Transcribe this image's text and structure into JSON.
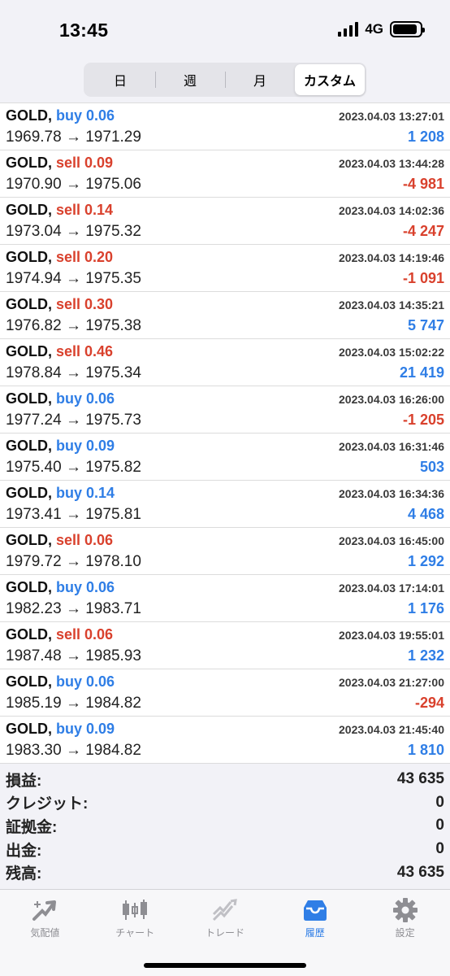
{
  "status": {
    "time": "13:45",
    "network": "4G",
    "battery_level": 0.9
  },
  "period_tabs": [
    {
      "label": "日",
      "active": false
    },
    {
      "label": "週",
      "active": false
    },
    {
      "label": "月",
      "active": false
    },
    {
      "label": "カスタム",
      "active": true
    }
  ],
  "trades": [
    {
      "symbol": "GOLD,",
      "side": "buy",
      "side_text": "buy 0.06",
      "prices": "1969.78 → 1971.29",
      "time": "2023.04.03 13:27:01",
      "profit": "1 208",
      "sign": "pos"
    },
    {
      "symbol": "GOLD,",
      "side": "sell",
      "side_text": "sell 0.09",
      "prices": "1970.90 → 1975.06",
      "time": "2023.04.03 13:44:28",
      "profit": "-4 981",
      "sign": "neg"
    },
    {
      "symbol": "GOLD,",
      "side": "sell",
      "side_text": "sell 0.14",
      "prices": "1973.04 → 1975.32",
      "time": "2023.04.03 14:02:36",
      "profit": "-4 247",
      "sign": "neg"
    },
    {
      "symbol": "GOLD,",
      "side": "sell",
      "side_text": "sell 0.20",
      "prices": "1974.94 → 1975.35",
      "time": "2023.04.03 14:19:46",
      "profit": "-1 091",
      "sign": "neg"
    },
    {
      "symbol": "GOLD,",
      "side": "sell",
      "side_text": "sell 0.30",
      "prices": "1976.82 → 1975.38",
      "time": "2023.04.03 14:35:21",
      "profit": "5 747",
      "sign": "pos"
    },
    {
      "symbol": "GOLD,",
      "side": "sell",
      "side_text": "sell 0.46",
      "prices": "1978.84 → 1975.34",
      "time": "2023.04.03 15:02:22",
      "profit": "21 419",
      "sign": "pos"
    },
    {
      "symbol": "GOLD,",
      "side": "buy",
      "side_text": "buy 0.06",
      "prices": "1977.24 → 1975.73",
      "time": "2023.04.03 16:26:00",
      "profit": "-1 205",
      "sign": "neg"
    },
    {
      "symbol": "GOLD,",
      "side": "buy",
      "side_text": "buy 0.09",
      "prices": "1975.40 → 1975.82",
      "time": "2023.04.03 16:31:46",
      "profit": "503",
      "sign": "pos"
    },
    {
      "symbol": "GOLD,",
      "side": "buy",
      "side_text": "buy 0.14",
      "prices": "1973.41 → 1975.81",
      "time": "2023.04.03 16:34:36",
      "profit": "4 468",
      "sign": "pos"
    },
    {
      "symbol": "GOLD,",
      "side": "sell",
      "side_text": "sell 0.06",
      "prices": "1979.72 → 1978.10",
      "time": "2023.04.03 16:45:00",
      "profit": "1 292",
      "sign": "pos"
    },
    {
      "symbol": "GOLD,",
      "side": "buy",
      "side_text": "buy 0.06",
      "prices": "1982.23 → 1983.71",
      "time": "2023.04.03 17:14:01",
      "profit": "1 176",
      "sign": "pos"
    },
    {
      "symbol": "GOLD,",
      "side": "sell",
      "side_text": "sell 0.06",
      "prices": "1987.48 → 1985.93",
      "time": "2023.04.03 19:55:01",
      "profit": "1 232",
      "sign": "pos"
    },
    {
      "symbol": "GOLD,",
      "side": "buy",
      "side_text": "buy 0.06",
      "prices": "1985.19 → 1984.82",
      "time": "2023.04.03 21:27:00",
      "profit": "-294",
      "sign": "neg"
    },
    {
      "symbol": "GOLD,",
      "side": "buy",
      "side_text": "buy 0.09",
      "prices": "1983.30 → 1984.82",
      "time": "2023.04.03 21:45:40",
      "profit": "1 810",
      "sign": "pos"
    }
  ],
  "summary": [
    {
      "label": "損益:",
      "value": "43 635"
    },
    {
      "label": "クレジット:",
      "value": "0"
    },
    {
      "label": "証拠金:",
      "value": "0"
    },
    {
      "label": "出金:",
      "value": "0"
    },
    {
      "label": "残高:",
      "value": "43 635"
    }
  ],
  "tabbar": [
    {
      "label": "気配値",
      "icon": "quotes-icon",
      "active": false
    },
    {
      "label": "チャート",
      "icon": "chart-icon",
      "active": false
    },
    {
      "label": "トレード",
      "icon": "trade-icon",
      "active": false
    },
    {
      "label": "履歴",
      "icon": "history-icon",
      "active": true
    },
    {
      "label": "設定",
      "icon": "settings-icon",
      "active": false
    }
  ],
  "colors": {
    "buy": "#2f7ee6",
    "sell": "#d9412d",
    "active_tab": "#2f7ee6",
    "inactive_icon": "#8e8e93"
  }
}
